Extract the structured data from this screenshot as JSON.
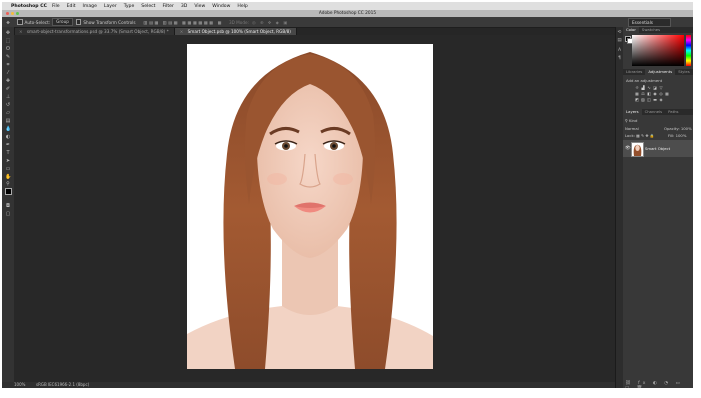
{
  "menubar": {
    "app_name": "Photoshop CC",
    "items": [
      "File",
      "Edit",
      "Image",
      "Layer",
      "Type",
      "Select",
      "Filter",
      "3D",
      "View",
      "Window",
      "Help"
    ]
  },
  "titlebar": {
    "title": "Adobe Photoshop CC 2015"
  },
  "workspace": {
    "label": "Essentials"
  },
  "options": {
    "auto_select_label": "Auto-Select:",
    "auto_select_value": "Group",
    "transform_controls_label": "Show Transform Controls",
    "mode_3d_label": "3D Mode:",
    "auto_select_checked": false,
    "transform_checked": false
  },
  "tabs": [
    {
      "label": "smart-object-transformations.psd @ 33.7% (Smart Object, RGB/8) *",
      "active": false
    },
    {
      "label": "Smart Object.psb @ 100% (Smart Object, RGB/8)",
      "active": true
    }
  ],
  "status": {
    "zoom": "100%",
    "doc": "sRGB IEC61966-2.1 (8bpc)"
  },
  "panels": {
    "color_tabs": [
      "Color",
      "Swatches"
    ],
    "adj_tabs": [
      "Libraries",
      "Adjustments",
      "Styles"
    ],
    "adj_label": "Add an adjustment",
    "layers_tabs": [
      "Layers",
      "Channels",
      "Paths"
    ],
    "kind_label": "Kind",
    "blend_mode": "Normal",
    "opacity_label": "Opacity:",
    "opacity_value": "100%",
    "lock_label": "Lock:",
    "fill_label": "Fill:",
    "fill_value": "100%",
    "layer_name": "Smart Object"
  },
  "colors": {
    "accent": "#dfdfdf",
    "panel": "#383838",
    "canvas": "#282828"
  }
}
